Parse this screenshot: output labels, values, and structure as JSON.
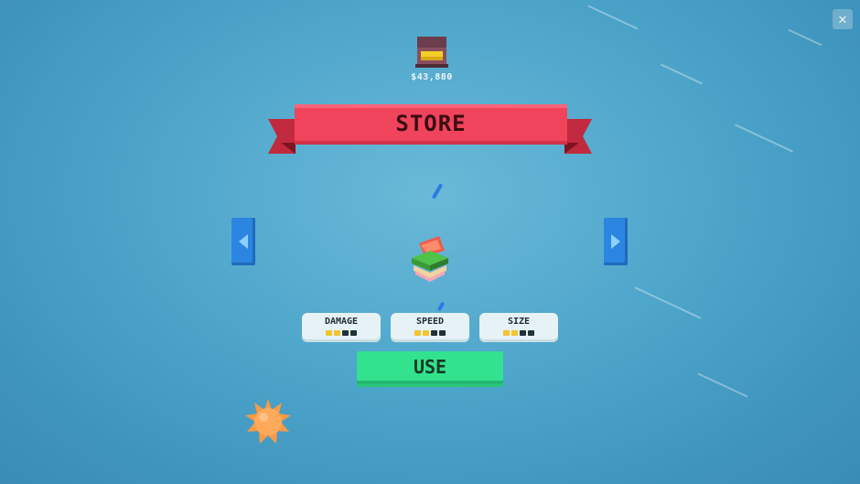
{
  "hud": {
    "coins": "$43,880",
    "close_icon": "close-icon"
  },
  "store": {
    "title": "STORE"
  },
  "stats": [
    {
      "label": "DAMAGE",
      "level": 2,
      "max": 4
    },
    {
      "label": "SPEED",
      "level": 2,
      "max": 4
    },
    {
      "label": "SIZE",
      "level": 2,
      "max": 4
    }
  ],
  "actions": {
    "use_label": "USE",
    "prev_icon": "arrow-left-icon",
    "next_icon": "arrow-right-icon"
  },
  "colors": {
    "banner": "#f0435c",
    "use_button": "#33e28e",
    "arrow_buttons": "#2a86e0",
    "pip_on": "#f1c431",
    "pip_off": "#203238"
  }
}
